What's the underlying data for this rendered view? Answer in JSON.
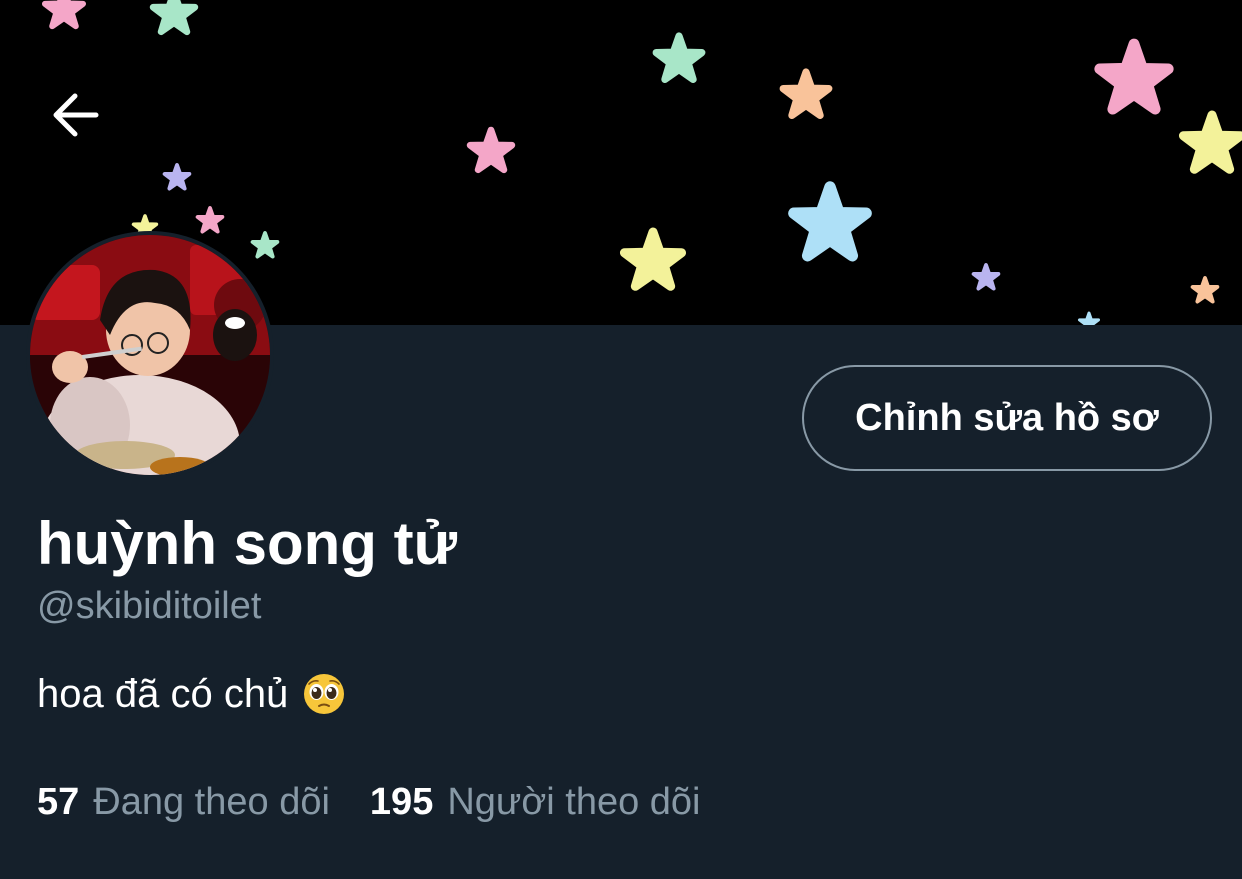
{
  "header": {
    "back_icon": "arrow-left-icon",
    "banner_pattern": "pastel-stars-on-black"
  },
  "colors": {
    "background": "#15202b",
    "banner": "#000000",
    "text_primary": "#ffffff",
    "text_secondary": "#8899a6",
    "button_border": "#8899a6"
  },
  "profile": {
    "display_name": "huỳnh song tử",
    "handle": "@skibiditoilet",
    "bio": "hoa đã có chủ",
    "bio_emoji": "pleading-face-emoji",
    "edit_button_label": "Chỉnh sửa hồ sơ"
  },
  "stats": {
    "following_count": "57",
    "following_label": "Đang theo dõi",
    "followers_count": "195",
    "followers_label": "Người theo dõi"
  }
}
